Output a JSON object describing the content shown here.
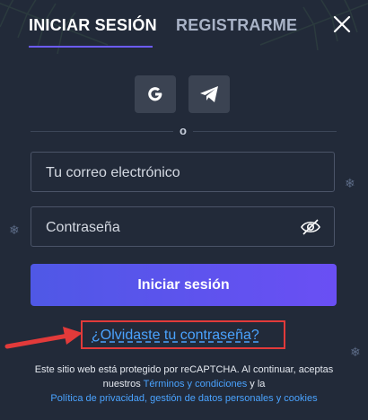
{
  "tabs": {
    "login": "INICIAR SESIÓN",
    "register": "REGISTRARME"
  },
  "social": {
    "google_icon": "google-icon",
    "telegram_icon": "telegram-icon"
  },
  "divider": "o",
  "email": {
    "placeholder": "Tu correo electrónico",
    "value": ""
  },
  "password": {
    "placeholder": "Contraseña",
    "value": ""
  },
  "submit_label": "Iniciar sesión",
  "forgot_link": "¿Olvidaste tu contraseña?",
  "legal": {
    "part1": "Este sitio web está protegido por reCAPTCHA. Al continuar, aceptas nuestros ",
    "terms_link": "Términos y condiciones",
    "part2": " y la ",
    "privacy_link": "Política de privacidad, gestión de datos personales y cookies"
  },
  "colors": {
    "accent": "#6c5cff",
    "link": "#4aa3ff",
    "highlight": "#e23a3a",
    "background": "#222a39"
  }
}
